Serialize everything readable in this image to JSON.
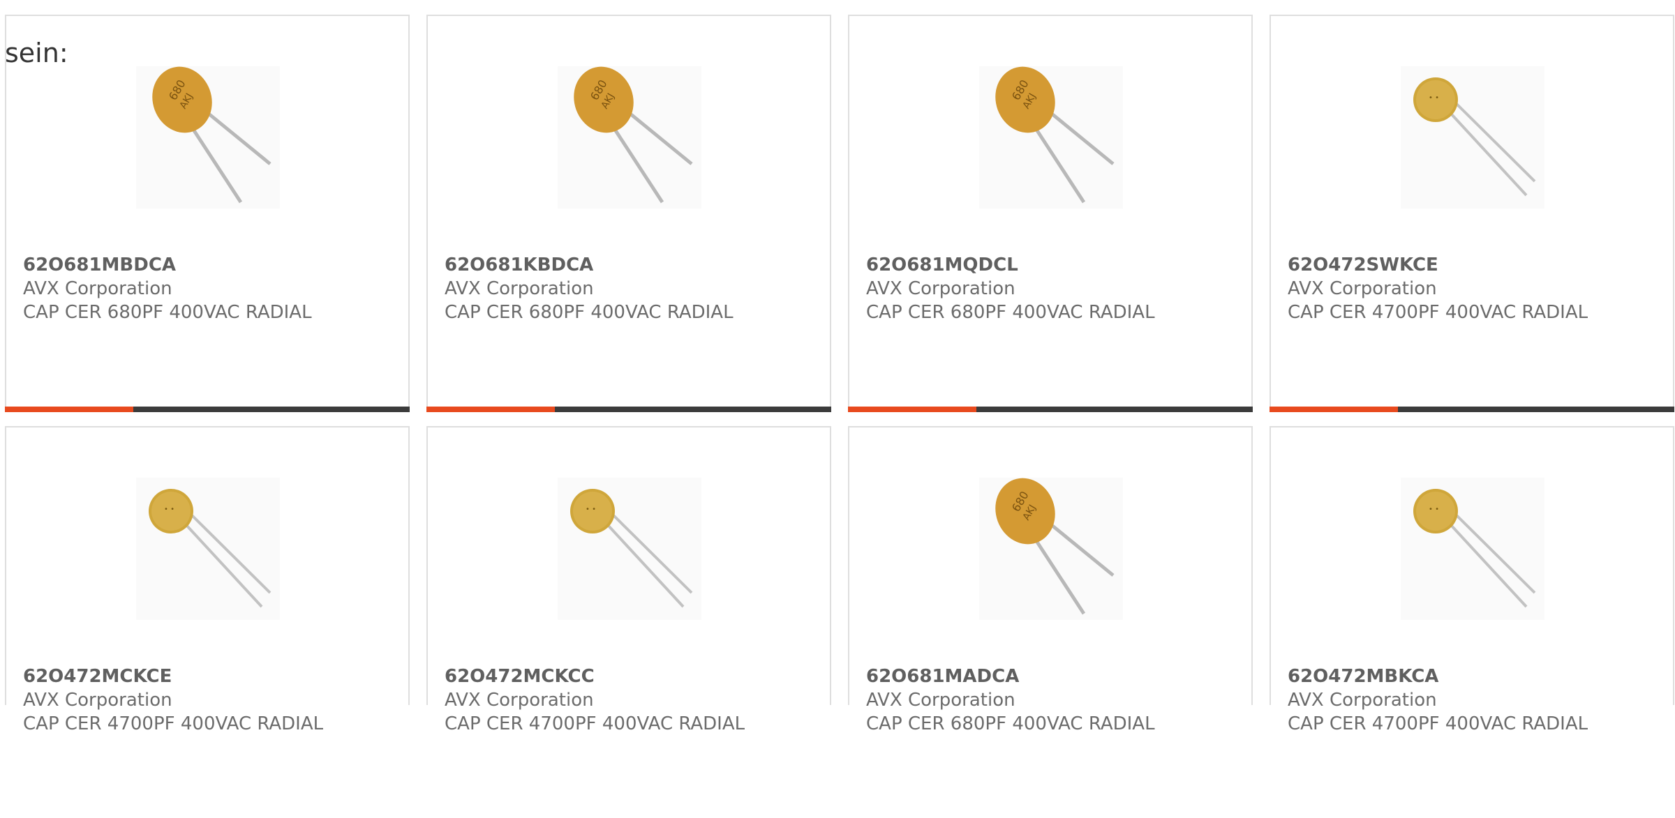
{
  "intro_label": "sein:",
  "products": [
    {
      "part_number": "62O681MBDCA",
      "manufacturer": "AVX Corporation",
      "description": "CAP CER 680PF 400VAC RADIAL",
      "image": "capacitor-disc-680-icon"
    },
    {
      "part_number": "62O681KBDCA",
      "manufacturer": "AVX Corporation",
      "description": "CAP CER 680PF 400VAC RADIAL",
      "image": "capacitor-disc-680-icon"
    },
    {
      "part_number": "62O681MQDCL",
      "manufacturer": "AVX Corporation",
      "description": "CAP CER 680PF 400VAC RADIAL",
      "image": "capacitor-disc-680-icon"
    },
    {
      "part_number": "62O472SWKCE",
      "manufacturer": "AVX Corporation",
      "description": "CAP CER 4700PF 400VAC RADIAL",
      "image": "capacitor-disc-small-icon"
    },
    {
      "part_number": "62O472MCKCE",
      "manufacturer": "AVX Corporation",
      "description": "CAP CER 4700PF 400VAC RADIAL",
      "image": "capacitor-disc-small-icon"
    },
    {
      "part_number": "62O472MCKCC",
      "manufacturer": "AVX Corporation",
      "description": "CAP CER 4700PF 400VAC RADIAL",
      "image": "capacitor-disc-small-icon"
    },
    {
      "part_number": "62O681MADCA",
      "manufacturer": "AVX Corporation",
      "description": "CAP CER 680PF 400VAC RADIAL",
      "image": "capacitor-disc-680-icon"
    },
    {
      "part_number": "62O472MBKCA",
      "manufacturer": "AVX Corporation",
      "description": "CAP CER 4700PF 400VAC RADIAL",
      "image": "capacitor-disc-small-icon"
    }
  ],
  "colors": {
    "accent": "#e84a1e",
    "bar": "#3b3b3b",
    "capacitor_body": "#d9a23a",
    "lead": "#b5b5b5"
  }
}
